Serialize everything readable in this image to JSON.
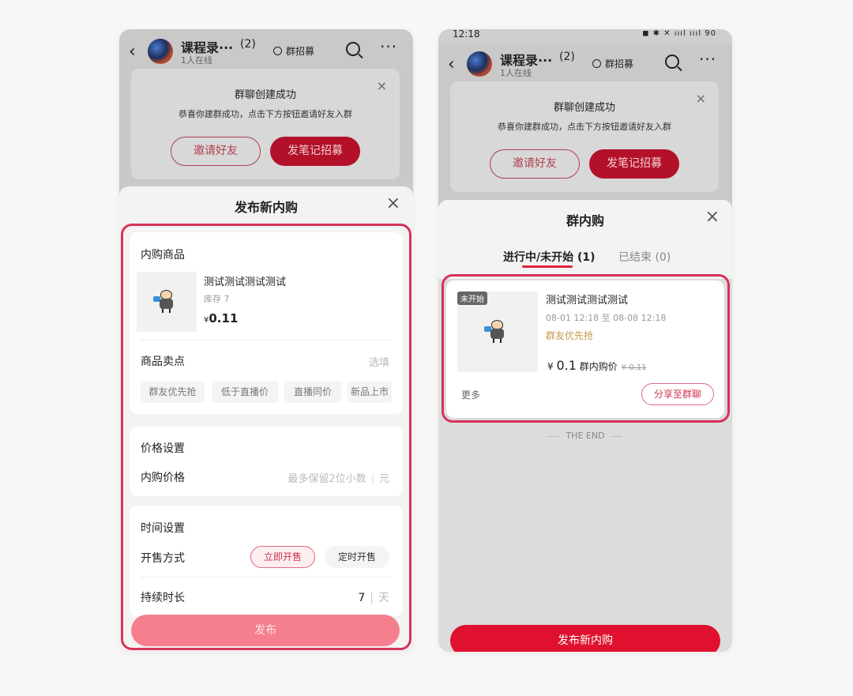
{
  "left": {
    "topbar": {
      "title": "课程录···",
      "count": "(2)",
      "online": "1人在线",
      "recruit": "群招募",
      "back_icon": "chevron-left-icon",
      "search_icon": "search-icon",
      "more_icon": "more-icon",
      "more": "···"
    },
    "notice": {
      "title": "群聊创建成功",
      "text": "恭喜你建群成功，点击下方按钮邀请好友入群",
      "invite": "邀请好友",
      "post": "发笔记招募",
      "close": "×"
    },
    "sheet": {
      "title": "发布新内购",
      "close": "×",
      "product": {
        "section": "内购商品",
        "name": "测试测试测试测试",
        "stock": "库存 7",
        "currency": "¥",
        "price": "0.11"
      },
      "selling": {
        "label": "商品卖点",
        "hint": "选填",
        "chips": [
          "群友优先抢",
          "低于直播价",
          "直播同价",
          "新品上市"
        ]
      },
      "price_setting": {
        "section": "价格设置",
        "label": "内购价格",
        "placeholder": "最多保留2位小数",
        "sep": "|",
        "unit": "元"
      },
      "time_setting": {
        "section": "时间设置",
        "sale_label": "开售方式",
        "opt_now": "立即开售",
        "opt_timed": "定时开售",
        "duration_label": "持续时长",
        "duration_value": "7",
        "sep": "|",
        "duration_unit": "天"
      },
      "publish": "发布"
    }
  },
  "right": {
    "status": {
      "time": "12:18",
      "icons": "◼ ✱ ✕ ıııl ıııl 90"
    },
    "topbar": {
      "title": "课程录···",
      "count": "(2)",
      "online": "1人在线",
      "recruit": "群招募",
      "more": "···"
    },
    "notice": {
      "title": "群聊创建成功",
      "text": "恭喜你建群成功，点击下方按钮邀请好友入群",
      "invite": "邀请好友",
      "post": "发笔记招募",
      "close": "×"
    },
    "sheet": {
      "title": "群内购",
      "close": "×",
      "tab_active": "进行中/未开始 (1)",
      "tab_inactive": "已结束 (0)",
      "item": {
        "badge": "未开始",
        "name": "测试测试测试测试",
        "dates": "08-01 12:18 至 08-08 12:18",
        "tag": "群友优先抢",
        "currency": "¥",
        "price": "0.1",
        "price_label": "群内购价",
        "original": "¥ 0.11",
        "more": "更多",
        "share": "分享至群聊"
      },
      "end": "THE END",
      "action": "发布新内购"
    }
  },
  "colors": {
    "accent": "#e0112e",
    "highlight": "#d7325a",
    "pill": "#d0334f"
  }
}
